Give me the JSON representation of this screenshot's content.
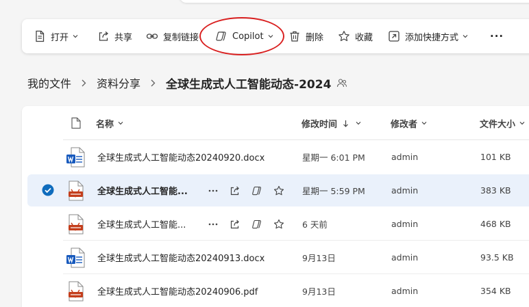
{
  "toolbar": {
    "open_label": "打开",
    "share_label": "共享",
    "copy_link_label": "复制链接",
    "copilot_label": "Copilot",
    "delete_label": "删除",
    "favorite_label": "收藏",
    "add_shortcut_label": "添加快捷方式",
    "more_label": "···"
  },
  "breadcrumb": {
    "root": "我的文件",
    "folder": "资料分享",
    "current": "全球生成式人工智能动态-2024"
  },
  "columns": {
    "name": "名称",
    "modified": "修改时间",
    "modified_by": "修改者",
    "size": "文件大小"
  },
  "files": [
    {
      "name": "全球生成式人工智能动态20240920.docx",
      "type": "word",
      "modified": "星期一 6:01 PM",
      "modified_by": "admin",
      "size": "101 KB",
      "selected": false
    },
    {
      "name": "全球生成式人工智能...",
      "type": "pdf",
      "modified": "星期一 5:59 PM",
      "modified_by": "admin",
      "size": "383 KB",
      "selected": true
    },
    {
      "name": "全球生成式人工智能...",
      "type": "pdf",
      "modified": "6 天前",
      "modified_by": "admin",
      "size": "468 KB",
      "selected": false
    },
    {
      "name": "全球生成式人工智能动态20240913.docx",
      "type": "word",
      "modified": "9月13日",
      "modified_by": "admin",
      "size": "93.5 KB",
      "selected": false
    },
    {
      "name": "全球生成式人工智能动态20240906.pdf",
      "type": "pdf",
      "modified": "9月13日",
      "modified_by": "admin",
      "size": "354 KB",
      "selected": false
    }
  ],
  "colors": {
    "accent": "#0f6cbd",
    "selected_row": "#eaf1fb",
    "highlight_ring": "#d92020",
    "word_blue": "#185abd",
    "pdf_red": "#c43e1c"
  }
}
